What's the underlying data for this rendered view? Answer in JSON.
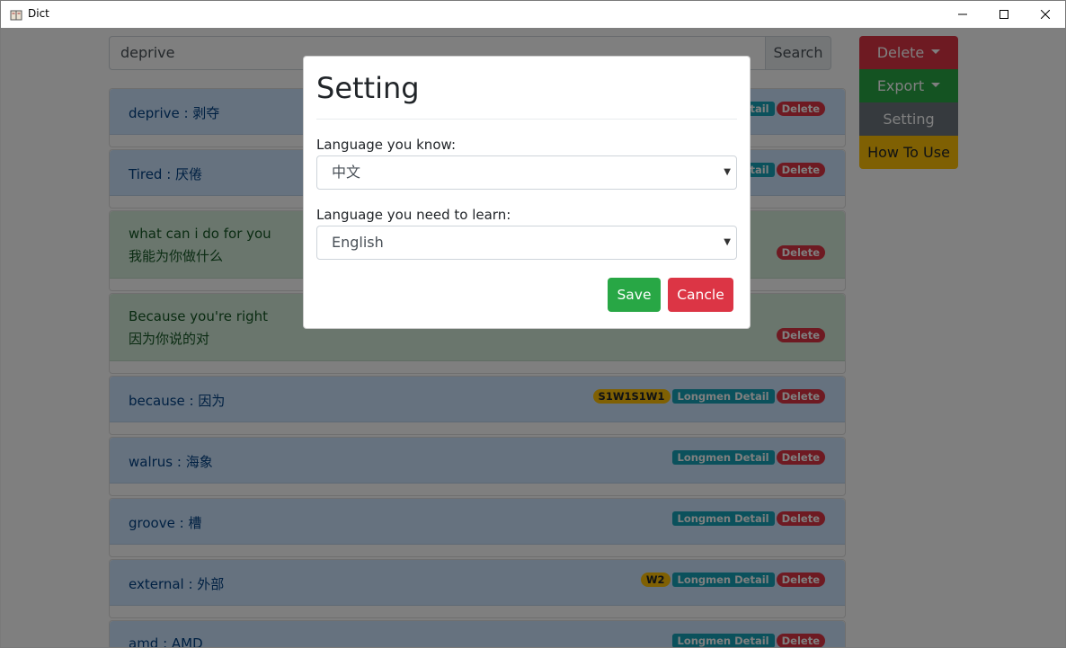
{
  "window": {
    "title": "Dict",
    "icon": "book-icon"
  },
  "search": {
    "value": "deprive",
    "button_label": "Search"
  },
  "sidebar": {
    "delete_label": "Delete",
    "export_label": "Export",
    "setting_label": "Setting",
    "how_to_use_label": "How To Use"
  },
  "words": [
    {
      "text": "deprive : 剥夺",
      "badges": [
        "Longmen Detail",
        "Delete"
      ]
    },
    {
      "text": "Tired : 厌倦",
      "badges": [
        "Longmen Detail",
        "Delete"
      ]
    },
    {
      "en": "what can i do for you",
      "zh": "我能为你做什么",
      "badges": [
        "Delete"
      ]
    },
    {
      "en": "Because you're right",
      "zh": "因为你说的对",
      "badges": [
        "Delete"
      ]
    },
    {
      "text": "because : 因为",
      "badges": [
        "S1W1S1W1",
        "Longmen Detail",
        "Delete"
      ]
    },
    {
      "text": "walrus : 海象",
      "badges": [
        "Longmen Detail",
        "Delete"
      ]
    },
    {
      "text": "groove : 槽",
      "badges": [
        "Longmen Detail",
        "Delete"
      ]
    },
    {
      "text": "external : 外部",
      "badges": [
        "W2",
        "Longmen Detail",
        "Delete"
      ]
    },
    {
      "text": "amd : AMD",
      "badges": [
        "Longmen Detail",
        "Delete"
      ]
    }
  ],
  "modal": {
    "title": "Setting",
    "know_label": "Language you know:",
    "know_value": "中文",
    "learn_label": "Language you need to learn:",
    "learn_value": "English",
    "save_label": "Save",
    "cancel_label": "Cancle"
  },
  "colors": {
    "primary_bg": "#cce5ff",
    "success_bg": "#d4edda",
    "danger": "#dc3545",
    "success": "#28a745",
    "secondary": "#6c757d",
    "warning": "#ffc107",
    "info": "#17a2b8"
  }
}
